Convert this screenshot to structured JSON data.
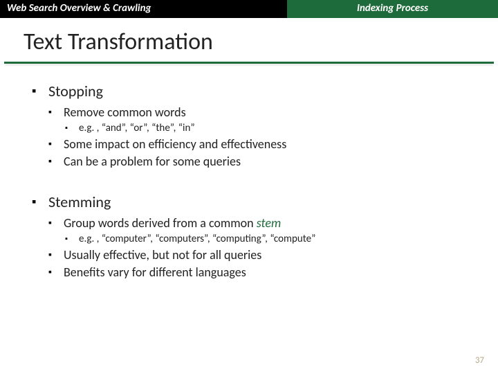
{
  "header": {
    "left": "Web Search Overview & Crawling",
    "right": "Indexing Process"
  },
  "title": "Text Transformation",
  "sections": [
    {
      "heading": "Stopping",
      "items": [
        {
          "text": "Remove common words",
          "sub": "e.g. , “and”, “or”, “the”, “in”"
        },
        {
          "text": "Some impact on efficiency and effectiveness"
        },
        {
          "text": "Can be a problem for some queries"
        }
      ]
    },
    {
      "heading": "Stemming",
      "items": [
        {
          "text_pre": "Group words derived from a common ",
          "stem_word": "stem",
          "sub": "e.g. , “computer”, “computers”, “computing”, “compute”"
        },
        {
          "text": "Usually effective, but not for all queries"
        },
        {
          "text": "Benefits vary for different languages"
        }
      ]
    }
  ],
  "page_number": "37"
}
